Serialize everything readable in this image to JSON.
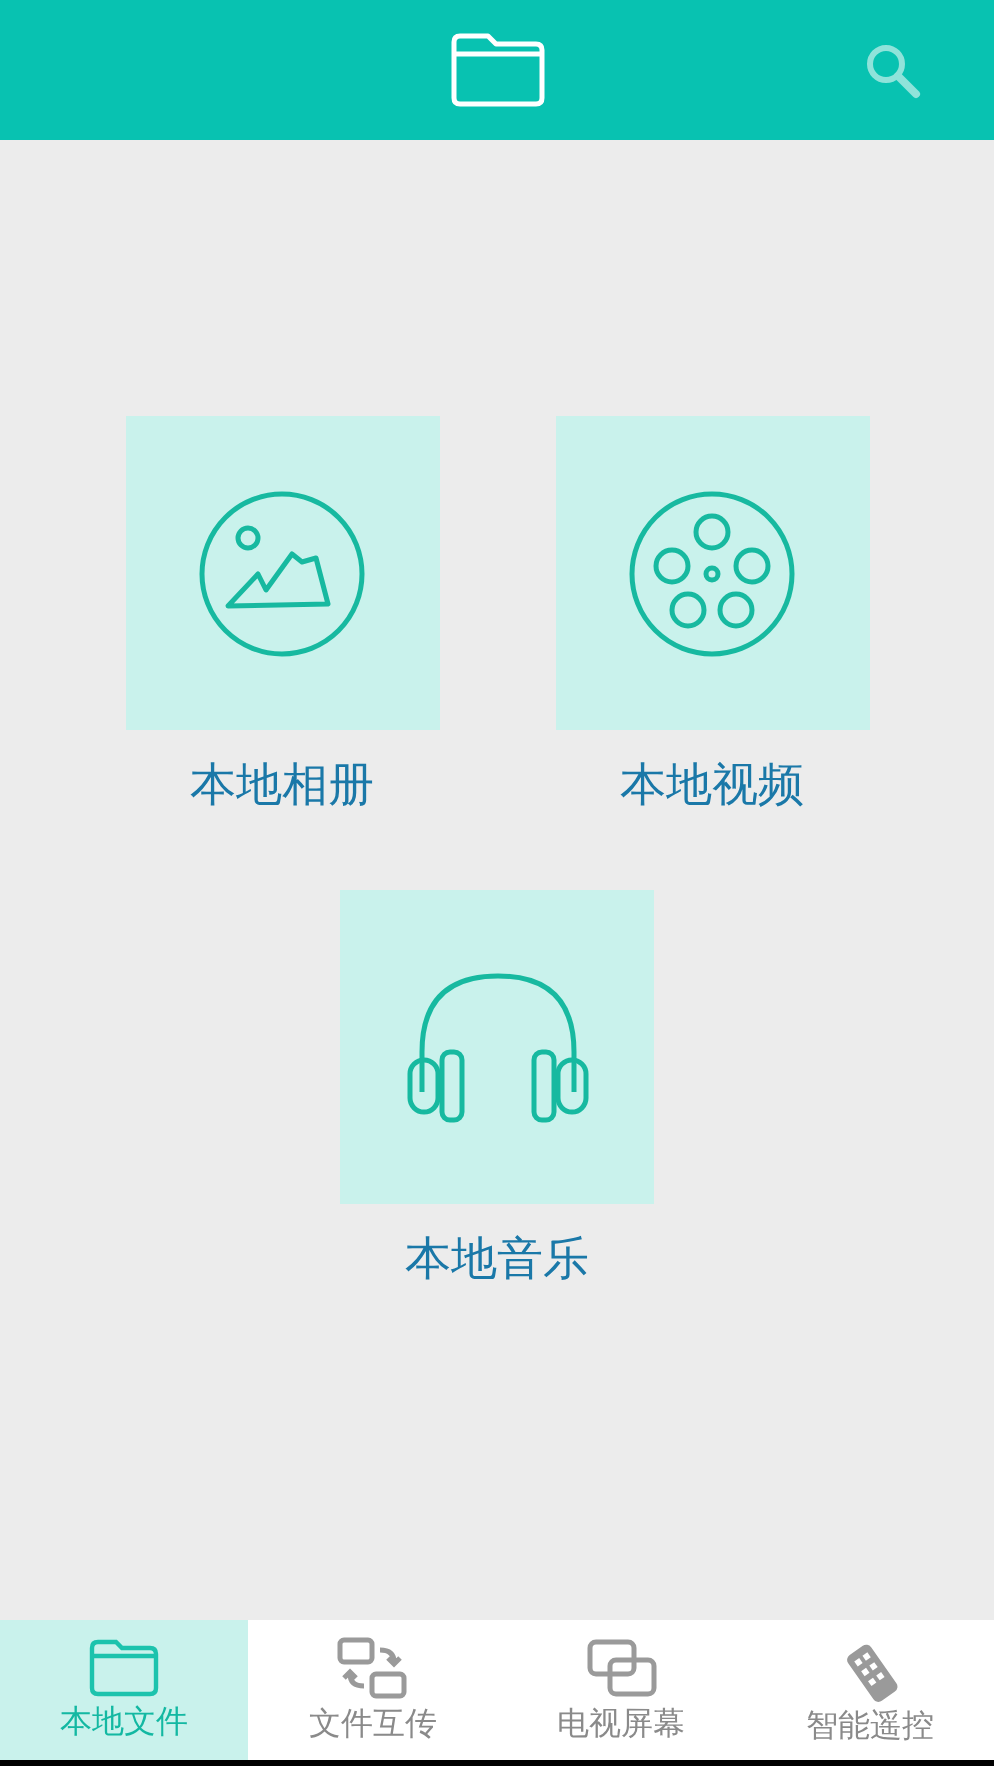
{
  "tiles": [
    {
      "kind": "photo",
      "label": "本地相册"
    },
    {
      "kind": "video",
      "label": "本地视频"
    },
    {
      "kind": "music",
      "label": "本地音乐"
    }
  ],
  "tabs": [
    {
      "kind": "folder",
      "label": "本地文件",
      "selected": true
    },
    {
      "kind": "transfer",
      "label": "文件互传",
      "selected": false
    },
    {
      "kind": "screen",
      "label": "电视屏幕",
      "selected": false
    },
    {
      "kind": "remote",
      "label": "智能遥控",
      "selected": false
    }
  ]
}
